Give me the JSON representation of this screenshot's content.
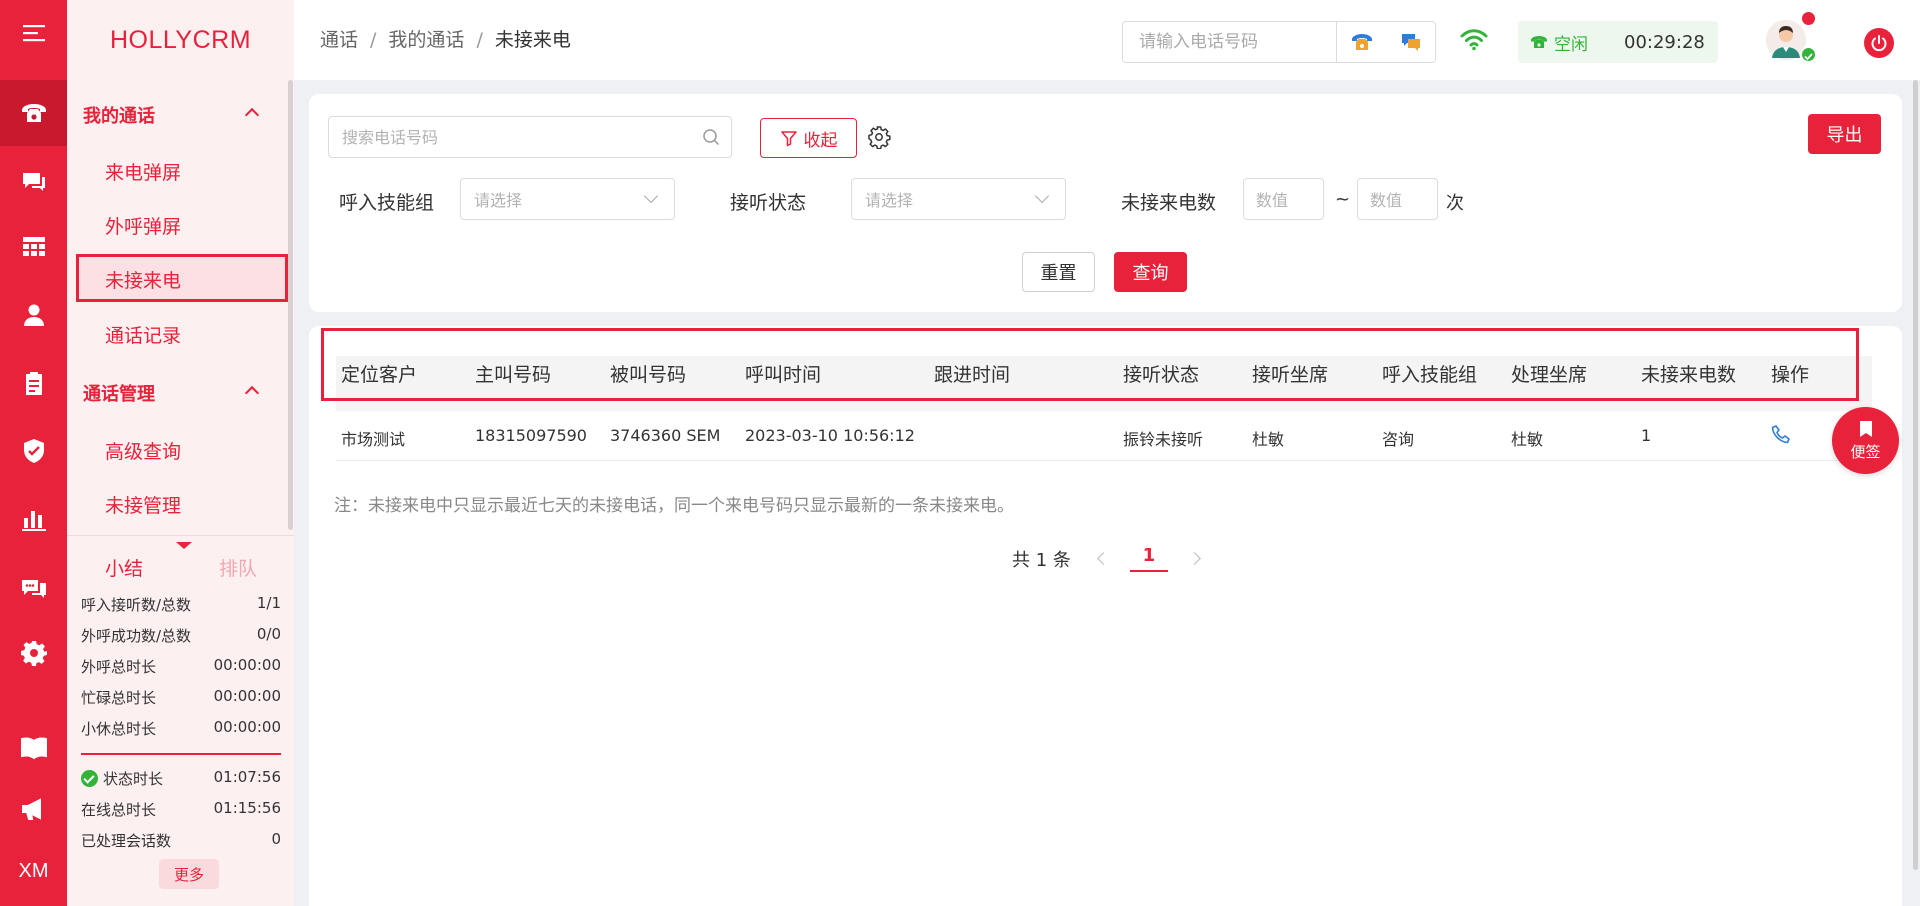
{
  "app": {
    "brand": "HOLLYCRM"
  },
  "rail": {
    "bottom_text": "XM"
  },
  "breadcrumb": {
    "level1": "通话",
    "level2": "我的通话",
    "current": "未接来电",
    "separator": "/"
  },
  "topbar": {
    "phone_placeholder": "请输入电话号码",
    "status_label": "空闲",
    "status_timer": "00:29:28"
  },
  "sidebar": {
    "groups": [
      {
        "title": "我的通话",
        "items": [
          "来电弹屏",
          "外呼弹屏",
          "未接来电",
          "通话记录"
        ]
      },
      {
        "title": "通话管理",
        "items": [
          "高级查询",
          "未接管理"
        ]
      }
    ],
    "active_item": "未接来电"
  },
  "stats": {
    "tab_summary": "小结",
    "tab_queue": "排队",
    "rows": [
      {
        "label": "呼入接听数/总数",
        "value": "1/1"
      },
      {
        "label": "外呼成功数/总数",
        "value": "0/0"
      },
      {
        "label": "外呼总时长",
        "value": "00:00:00"
      },
      {
        "label": "忙碌总时长",
        "value": "00:00:00"
      },
      {
        "label": "小休总时长",
        "value": "00:00:00"
      }
    ],
    "rows2": [
      {
        "label": "状态时长",
        "value": "01:07:56"
      },
      {
        "label": "在线总时长",
        "value": "01:15:56"
      },
      {
        "label": "已处理会话数",
        "value": "0"
      }
    ],
    "more_label": "更多"
  },
  "filters": {
    "search_placeholder": "搜索电话号码",
    "collapse_label": "收起",
    "export_label": "导出",
    "skill_group_label": "呼入技能组",
    "skill_group_placeholder": "请选择",
    "answer_status_label": "接听状态",
    "answer_status_placeholder": "请选择",
    "missed_count_label": "未接来电数",
    "num_placeholder_from": "数值",
    "num_placeholder_to": "数值",
    "range_sep": "~",
    "unit": "次",
    "reset_label": "重置",
    "query_label": "查询"
  },
  "table": {
    "columns": [
      "定位客户",
      "主叫号码",
      "被叫号码",
      "呼叫时间",
      "跟进时间",
      "接听状态",
      "接听坐席",
      "呼入技能组",
      "处理坐席",
      "未接来电数",
      "操作"
    ],
    "rows": [
      [
        "市场测试",
        "18315097590",
        "3746360 SEM",
        "2023-03-10 10:56:12",
        "",
        "振铃未接听",
        "杜敏",
        "咨询",
        "杜敏",
        "1"
      ]
    ],
    "note": "注：未接来电中只显示最近七天的未接电话，同一个来电号码只显示最新的一条未接来电。",
    "pager_total": "共 1 条",
    "pager_current": "1"
  },
  "floating": {
    "sticky_note_label": "便签"
  },
  "colors": {
    "primary": "#e8223a",
    "success": "#33b33a",
    "sidebar_bg": "#fdf0f1"
  }
}
